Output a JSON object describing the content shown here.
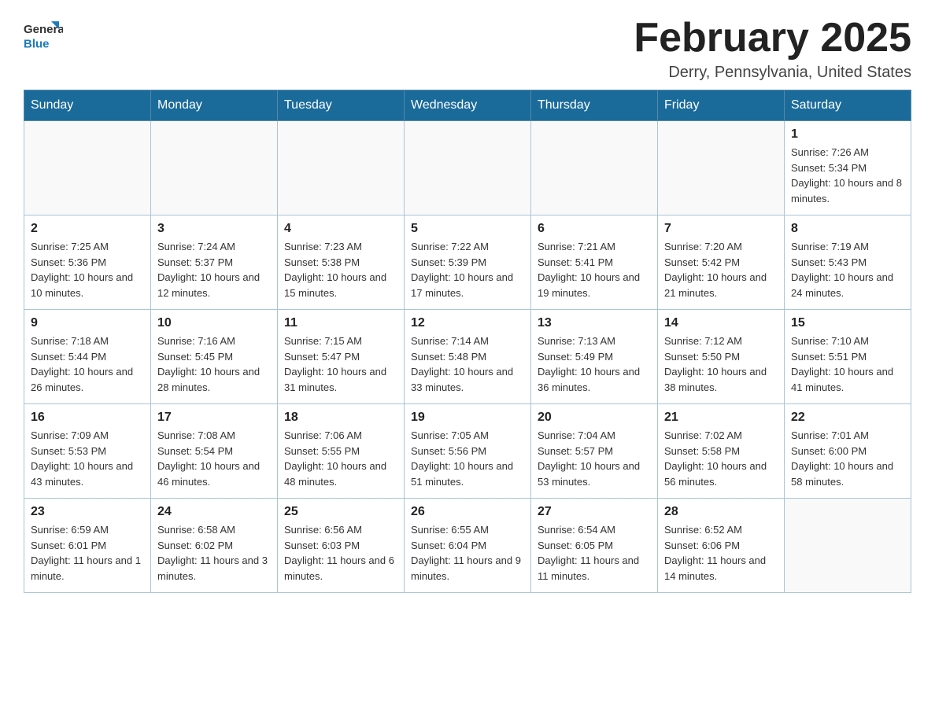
{
  "header": {
    "logo_general": "General",
    "logo_blue": "Blue",
    "month_title": "February 2025",
    "location": "Derry, Pennsylvania, United States"
  },
  "days_of_week": [
    "Sunday",
    "Monday",
    "Tuesday",
    "Wednesday",
    "Thursday",
    "Friday",
    "Saturday"
  ],
  "weeks": [
    [
      {
        "day": "",
        "info": ""
      },
      {
        "day": "",
        "info": ""
      },
      {
        "day": "",
        "info": ""
      },
      {
        "day": "",
        "info": ""
      },
      {
        "day": "",
        "info": ""
      },
      {
        "day": "",
        "info": ""
      },
      {
        "day": "1",
        "info": "Sunrise: 7:26 AM\nSunset: 5:34 PM\nDaylight: 10 hours and 8 minutes."
      }
    ],
    [
      {
        "day": "2",
        "info": "Sunrise: 7:25 AM\nSunset: 5:36 PM\nDaylight: 10 hours and 10 minutes."
      },
      {
        "day": "3",
        "info": "Sunrise: 7:24 AM\nSunset: 5:37 PM\nDaylight: 10 hours and 12 minutes."
      },
      {
        "day": "4",
        "info": "Sunrise: 7:23 AM\nSunset: 5:38 PM\nDaylight: 10 hours and 15 minutes."
      },
      {
        "day": "5",
        "info": "Sunrise: 7:22 AM\nSunset: 5:39 PM\nDaylight: 10 hours and 17 minutes."
      },
      {
        "day": "6",
        "info": "Sunrise: 7:21 AM\nSunset: 5:41 PM\nDaylight: 10 hours and 19 minutes."
      },
      {
        "day": "7",
        "info": "Sunrise: 7:20 AM\nSunset: 5:42 PM\nDaylight: 10 hours and 21 minutes."
      },
      {
        "day": "8",
        "info": "Sunrise: 7:19 AM\nSunset: 5:43 PM\nDaylight: 10 hours and 24 minutes."
      }
    ],
    [
      {
        "day": "9",
        "info": "Sunrise: 7:18 AM\nSunset: 5:44 PM\nDaylight: 10 hours and 26 minutes."
      },
      {
        "day": "10",
        "info": "Sunrise: 7:16 AM\nSunset: 5:45 PM\nDaylight: 10 hours and 28 minutes."
      },
      {
        "day": "11",
        "info": "Sunrise: 7:15 AM\nSunset: 5:47 PM\nDaylight: 10 hours and 31 minutes."
      },
      {
        "day": "12",
        "info": "Sunrise: 7:14 AM\nSunset: 5:48 PM\nDaylight: 10 hours and 33 minutes."
      },
      {
        "day": "13",
        "info": "Sunrise: 7:13 AM\nSunset: 5:49 PM\nDaylight: 10 hours and 36 minutes."
      },
      {
        "day": "14",
        "info": "Sunrise: 7:12 AM\nSunset: 5:50 PM\nDaylight: 10 hours and 38 minutes."
      },
      {
        "day": "15",
        "info": "Sunrise: 7:10 AM\nSunset: 5:51 PM\nDaylight: 10 hours and 41 minutes."
      }
    ],
    [
      {
        "day": "16",
        "info": "Sunrise: 7:09 AM\nSunset: 5:53 PM\nDaylight: 10 hours and 43 minutes."
      },
      {
        "day": "17",
        "info": "Sunrise: 7:08 AM\nSunset: 5:54 PM\nDaylight: 10 hours and 46 minutes."
      },
      {
        "day": "18",
        "info": "Sunrise: 7:06 AM\nSunset: 5:55 PM\nDaylight: 10 hours and 48 minutes."
      },
      {
        "day": "19",
        "info": "Sunrise: 7:05 AM\nSunset: 5:56 PM\nDaylight: 10 hours and 51 minutes."
      },
      {
        "day": "20",
        "info": "Sunrise: 7:04 AM\nSunset: 5:57 PM\nDaylight: 10 hours and 53 minutes."
      },
      {
        "day": "21",
        "info": "Sunrise: 7:02 AM\nSunset: 5:58 PM\nDaylight: 10 hours and 56 minutes."
      },
      {
        "day": "22",
        "info": "Sunrise: 7:01 AM\nSunset: 6:00 PM\nDaylight: 10 hours and 58 minutes."
      }
    ],
    [
      {
        "day": "23",
        "info": "Sunrise: 6:59 AM\nSunset: 6:01 PM\nDaylight: 11 hours and 1 minute."
      },
      {
        "day": "24",
        "info": "Sunrise: 6:58 AM\nSunset: 6:02 PM\nDaylight: 11 hours and 3 minutes."
      },
      {
        "day": "25",
        "info": "Sunrise: 6:56 AM\nSunset: 6:03 PM\nDaylight: 11 hours and 6 minutes."
      },
      {
        "day": "26",
        "info": "Sunrise: 6:55 AM\nSunset: 6:04 PM\nDaylight: 11 hours and 9 minutes."
      },
      {
        "day": "27",
        "info": "Sunrise: 6:54 AM\nSunset: 6:05 PM\nDaylight: 11 hours and 11 minutes."
      },
      {
        "day": "28",
        "info": "Sunrise: 6:52 AM\nSunset: 6:06 PM\nDaylight: 11 hours and 14 minutes."
      },
      {
        "day": "",
        "info": ""
      }
    ]
  ]
}
